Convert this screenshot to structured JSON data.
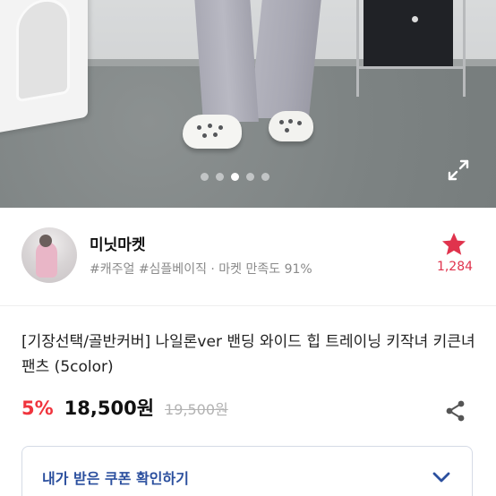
{
  "gallery": {
    "total_images": 5,
    "active_index": 3,
    "expand_icon": "expand-icon"
  },
  "shop": {
    "name": "미닛마켓",
    "meta": "#캐주얼 #심플베이직 · 마켓 만족도 91%",
    "like_count": "1,284",
    "like_icon": "star-icon",
    "like_color": "#e0334d"
  },
  "product": {
    "title": "[기장선택/골반커버] 나일론ver 밴딩 와이드 힙 트레이닝 키작녀 키큰녀 팬츠 (5color)",
    "discount": "5%",
    "price": "18,500원",
    "original_price": "19,500원",
    "share_icon": "share-icon"
  },
  "coupon": {
    "label": "내가 받은 쿠폰 확인하기",
    "icon": "chevron-down-icon"
  },
  "colors": {
    "accent_red": "#f0343d",
    "coupon_blue": "#2b4f9e"
  }
}
